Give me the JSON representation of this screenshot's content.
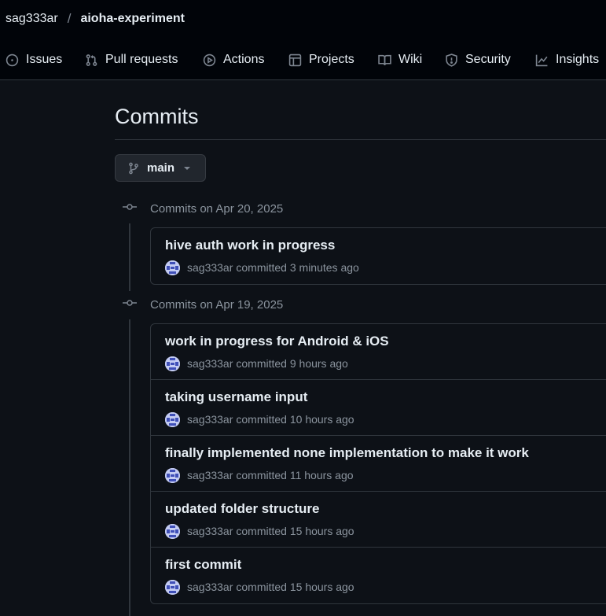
{
  "breadcrumb": {
    "owner": "sag333ar",
    "separator": "/",
    "repo": "aioha-experiment"
  },
  "tabs": [
    {
      "label": "Issues",
      "icon": "issue-opened-icon"
    },
    {
      "label": "Pull requests",
      "icon": "git-pull-request-icon"
    },
    {
      "label": "Actions",
      "icon": "play-icon"
    },
    {
      "label": "Projects",
      "icon": "table-icon"
    },
    {
      "label": "Wiki",
      "icon": "book-icon"
    },
    {
      "label": "Security",
      "icon": "shield-icon"
    },
    {
      "label": "Insights",
      "icon": "graph-icon"
    }
  ],
  "page": {
    "title": "Commits",
    "branch": "main"
  },
  "groups": [
    {
      "label": "Commits on Apr 20, 2025",
      "commits": [
        {
          "title": "hive auth work in progress",
          "author": "sag333ar",
          "meta": "committed 3 minutes ago"
        }
      ]
    },
    {
      "label": "Commits on Apr 19, 2025",
      "commits": [
        {
          "title": "work in progress for Android & iOS",
          "author": "sag333ar",
          "meta": "committed 9 hours ago"
        },
        {
          "title": "taking username input",
          "author": "sag333ar",
          "meta": "committed 10 hours ago"
        },
        {
          "title": "finally implemented none implementation to make it work",
          "author": "sag333ar",
          "meta": "committed 11 hours ago"
        },
        {
          "title": "updated folder structure",
          "author": "sag333ar",
          "meta": "committed 15 hours ago"
        },
        {
          "title": "first commit",
          "author": "sag333ar",
          "meta": "committed 15 hours ago"
        }
      ]
    }
  ],
  "colors": {
    "background": "#0d1117",
    "header": "#010409",
    "border": "#30363d",
    "muted": "#8b949e",
    "text": "#e6edf3"
  }
}
